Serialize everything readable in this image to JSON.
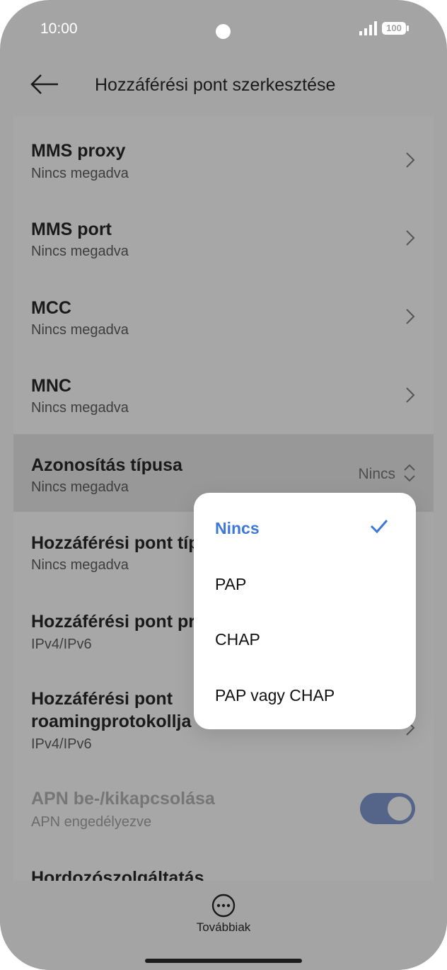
{
  "status_bar": {
    "time": "10:00",
    "battery": "100",
    "icons": [
      "signal-icon",
      "battery-icon"
    ]
  },
  "header": {
    "title": "Hozzáférési pont szerkesztése",
    "back_icon": "arrow-left-icon"
  },
  "rows": [
    {
      "title": "MMS proxy",
      "subtitle": "Nincs megadva"
    },
    {
      "title": "MMS port",
      "subtitle": "Nincs megadva"
    },
    {
      "title": "MCC",
      "subtitle": "Nincs megadva"
    },
    {
      "title": "MNC",
      "subtitle": "Nincs megadva"
    },
    {
      "title": "Azonosítás típusa",
      "subtitle": "Nincs megadva",
      "value": "Nincs"
    },
    {
      "title": "Hozzáférési pont típ",
      "subtitle": "Nincs megadva"
    },
    {
      "title": "Hozzáférési pont pr",
      "subtitle": "IPv4/IPv6"
    },
    {
      "title_line1": "Hozzáférési pont",
      "title_line2": "roamingprotokollja",
      "subtitle": "IPv4/IPv6"
    },
    {
      "title": "APN be-/kikapcsolása",
      "subtitle": "APN engedélyezve",
      "toggle_on": true
    },
    {
      "title": "Hordozószolgáltatás"
    }
  ],
  "popup": {
    "options": [
      "Nincs",
      "PAP",
      "CHAP",
      "PAP vagy CHAP"
    ],
    "selected": "Nincs"
  },
  "bottom_bar": {
    "label": "Továbbiak",
    "icon": "more-horizontal-icon"
  },
  "colors": {
    "accent": "#3d78d8",
    "toggle": "#55658a",
    "overlay": "#a4a4a4"
  }
}
